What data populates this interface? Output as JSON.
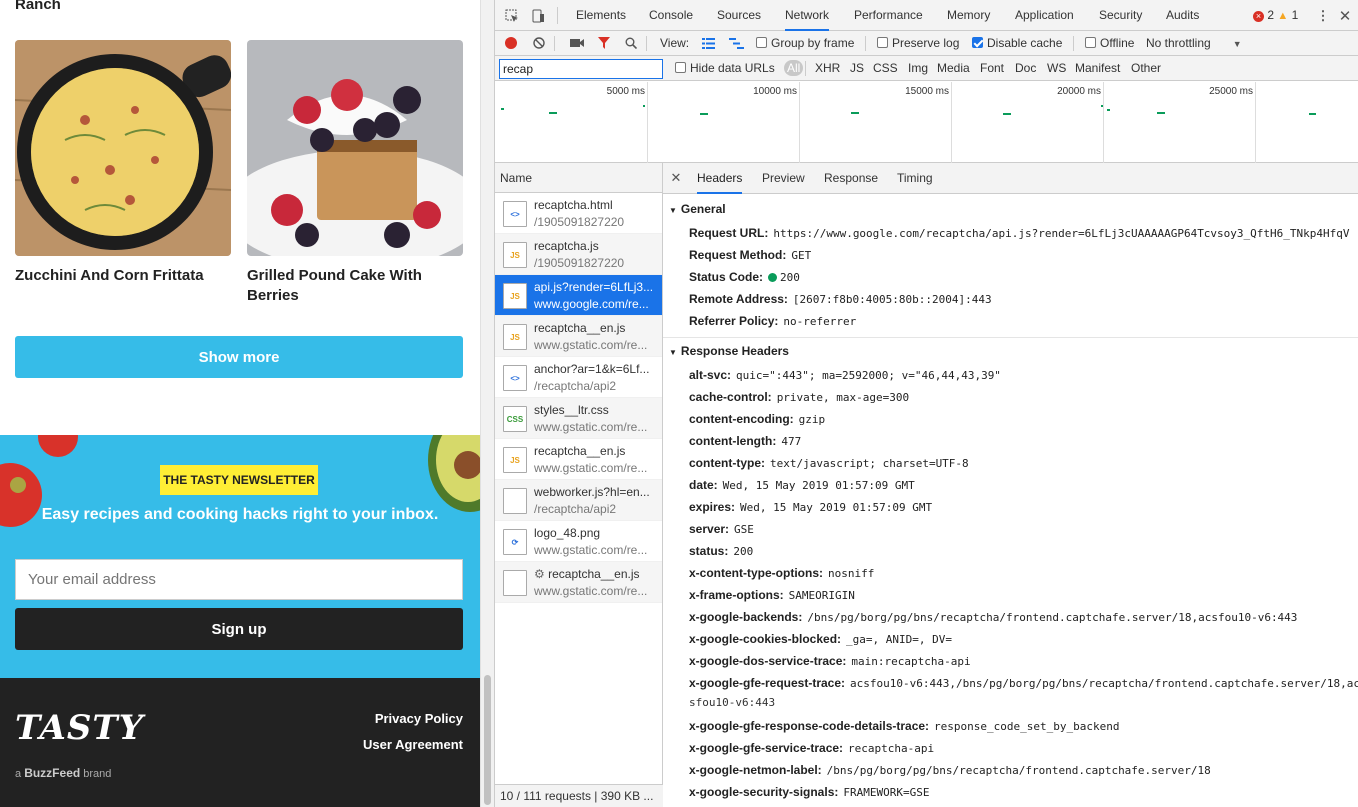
{
  "page": {
    "partial_title": "Ranch",
    "cards": [
      {
        "title": "Zucchini And Corn Frittata"
      },
      {
        "title": "Grilled Pound Cake With Berries"
      }
    ],
    "show_more": "Show more",
    "newsletter": {
      "badge": "THE TASTY NEWSLETTER",
      "text": "Easy recipes and cooking hacks right to your inbox.",
      "email_placeholder": "Your email address",
      "signup": "Sign up"
    },
    "footer": {
      "logo": "TASTY",
      "brand_prefix": "a",
      "brand_name": "BuzzFeed",
      "brand_suffix": "brand",
      "links": [
        "Privacy Policy",
        "User Agreement"
      ]
    }
  },
  "devtools": {
    "tabs": [
      "Elements",
      "Console",
      "Sources",
      "Network",
      "Performance",
      "Memory",
      "Application",
      "Security",
      "Audits"
    ],
    "active_tab": "Network",
    "errors": "2",
    "warnings": "1",
    "toolbar": {
      "view_label": "View:",
      "group_by_frame": "Group by frame",
      "preserve_log": "Preserve log",
      "disable_cache": "Disable cache",
      "offline": "Offline",
      "throttling": "No throttling"
    },
    "filter": {
      "value": "recap",
      "hide_data_urls": "Hide data URLs",
      "types": [
        "All",
        "XHR",
        "JS",
        "CSS",
        "Img",
        "Media",
        "Font",
        "Doc",
        "WS",
        "Manifest",
        "Other"
      ]
    },
    "overview_labels": [
      "5000 ms",
      "10000 ms",
      "15000 ms",
      "20000 ms",
      "25000 ms"
    ],
    "name_header": "Name",
    "requests": [
      {
        "name": "recaptcha.html",
        "sub": "/1905091827220",
        "icon": "<>",
        "type": "html"
      },
      {
        "name": "recaptcha.js",
        "sub": "/1905091827220",
        "icon": "JS",
        "type": "js"
      },
      {
        "name": "api.js?render=6LfLj3...",
        "sub": "www.google.com/re...",
        "icon": "JS",
        "type": "js",
        "selected": true
      },
      {
        "name": "recaptcha__en.js",
        "sub": "www.gstatic.com/re...",
        "icon": "JS",
        "type": "js"
      },
      {
        "name": "anchor?ar=1&k=6Lf...",
        "sub": "/recaptcha/api2",
        "icon": "<>",
        "type": "html"
      },
      {
        "name": "styles__ltr.css",
        "sub": "www.gstatic.com/re...",
        "icon": "CSS",
        "type": "css"
      },
      {
        "name": "recaptcha__en.js",
        "sub": "www.gstatic.com/re...",
        "icon": "JS",
        "type": "js"
      },
      {
        "name": "webworker.js?hl=en...",
        "sub": "/recaptcha/api2",
        "icon": "",
        "type": "doc"
      },
      {
        "name": "logo_48.png",
        "sub": "www.gstatic.com/re...",
        "icon": "⟳",
        "type": "img"
      },
      {
        "name": "recaptcha__en.js",
        "sub": "www.gstatic.com/re...",
        "icon": "",
        "type": "doc",
        "gear": true
      }
    ],
    "summary": "10 / 111 requests | 390 KB ...",
    "detail_tabs": [
      "Headers",
      "Preview",
      "Response",
      "Timing"
    ],
    "general_title": "General",
    "general": [
      {
        "k": "Request URL:",
        "v": "https://www.google.com/recaptcha/api.js?render=6LfLj3cUAAAAAGP64Tcvsoy3_QftH6_TNkp4HfqV"
      },
      {
        "k": "Request Method:",
        "v": "GET"
      },
      {
        "k": "Status Code:",
        "v": "200",
        "dot": true
      },
      {
        "k": "Remote Address:",
        "v": "[2607:f8b0:4005:80b::2004]:443"
      },
      {
        "k": "Referrer Policy:",
        "v": "no-referrer"
      }
    ],
    "response_title": "Response Headers",
    "response_headers": [
      {
        "k": "alt-svc:",
        "v": "quic=\":443\"; ma=2592000; v=\"46,44,43,39\""
      },
      {
        "k": "cache-control:",
        "v": "private, max-age=300"
      },
      {
        "k": "content-encoding:",
        "v": "gzip"
      },
      {
        "k": "content-length:",
        "v": "477"
      },
      {
        "k": "content-type:",
        "v": "text/javascript; charset=UTF-8"
      },
      {
        "k": "date:",
        "v": "Wed, 15 May 2019 01:57:09 GMT"
      },
      {
        "k": "expires:",
        "v": "Wed, 15 May 2019 01:57:09 GMT"
      },
      {
        "k": "server:",
        "v": "GSE"
      },
      {
        "k": "status:",
        "v": "200"
      },
      {
        "k": "x-content-type-options:",
        "v": "nosniff"
      },
      {
        "k": "x-frame-options:",
        "v": "SAMEORIGIN"
      },
      {
        "k": "x-google-backends:",
        "v": "/bns/pg/borg/pg/bns/recaptcha/frontend.captchafe.server/18,acsfou10-v6:443"
      },
      {
        "k": "x-google-cookies-blocked:",
        "v": "_ga=, ANID=, DV="
      },
      {
        "k": "x-google-dos-service-trace:",
        "v": "main:recaptcha-api"
      },
      {
        "k": "x-google-gfe-request-trace:",
        "v": "acsfou10-v6:443,/bns/pg/borg/pg/bns/recaptcha/frontend.captchafe.server/18,ac",
        "cont": "sfou10-v6:443"
      },
      {
        "k": "x-google-gfe-response-code-details-trace:",
        "v": "response_code_set_by_backend"
      },
      {
        "k": "x-google-gfe-service-trace:",
        "v": "recaptcha-api"
      },
      {
        "k": "x-google-netmon-label:",
        "v": "/bns/pg/borg/pg/bns/recaptcha/frontend.captchafe.server/18"
      },
      {
        "k": "x-google-security-signals:",
        "v": "FRAMEWORK=GSE"
      }
    ]
  }
}
